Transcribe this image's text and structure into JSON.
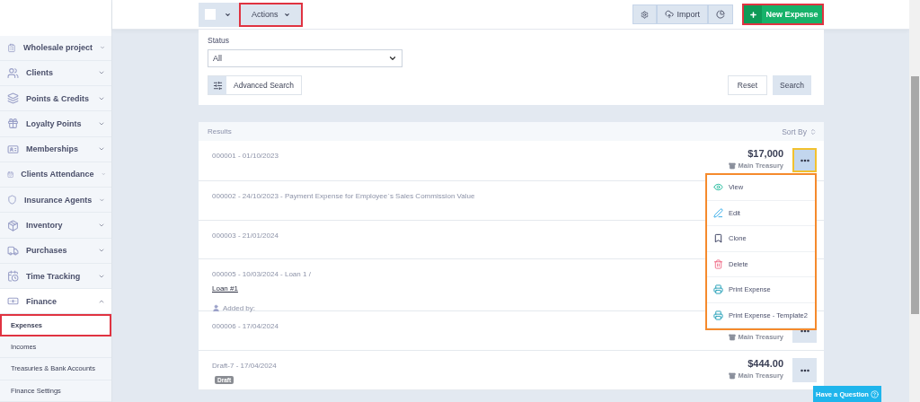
{
  "sidebar": {
    "items": [
      {
        "label": "Wholesale project",
        "expanded": false
      },
      {
        "label": "Clients",
        "expanded": false
      },
      {
        "label": "Points & Credits",
        "expanded": false
      },
      {
        "label": "Loyalty Points",
        "expanded": false
      },
      {
        "label": "Memberships",
        "expanded": false
      },
      {
        "label": "Clients Attendance",
        "expanded": false
      },
      {
        "label": "Insurance Agents",
        "expanded": false
      },
      {
        "label": "Inventory",
        "expanded": false
      },
      {
        "label": "Purchases",
        "expanded": false
      },
      {
        "label": "Time Tracking",
        "expanded": false
      },
      {
        "label": "Finance",
        "expanded": true,
        "children": [
          {
            "label": "Expenses",
            "selected": true,
            "highlighted": true
          },
          {
            "label": "Incomes",
            "selected": false,
            "highlighted": false
          },
          {
            "label": "Treasuries & Bank Accounts",
            "selected": false,
            "highlighted": false
          },
          {
            "label": "Finance Settings",
            "selected": false,
            "highlighted": false
          }
        ]
      }
    ]
  },
  "toolbar": {
    "select_all": {
      "checked": false
    },
    "actions": {
      "label": "Actions",
      "highlighted": true
    },
    "import": "Import",
    "new_button": {
      "label": "New Expense",
      "highlighted": true
    }
  },
  "filters": {
    "status_label": "Status",
    "status_value": "All",
    "advanced_search": "Advanced Search",
    "reset": "Reset",
    "search": "Search"
  },
  "results": {
    "title": "Results",
    "sort": "Sort By",
    "rows": [
      {
        "title": "000001 - 01/10/2023",
        "amount": "$17,000",
        "treasury": "Main Treasury",
        "actions_visible": true,
        "menu_open": true
      },
      {
        "title": "000002 - 24/10/2023 - Payment Expense for Employee`s Sales Commission Value",
        "actions_visible": false,
        "menu_open": false
      },
      {
        "title": "000003 - 21/01/2024",
        "actions_visible": false,
        "menu_open": false
      },
      {
        "title": "000005 - 10/03/2024 - Loan 1 /",
        "link": "Loan #1",
        "added_by": "Added by:",
        "actions_visible": false,
        "menu_open": false
      },
      {
        "title": "000006 - 17/04/2024",
        "treasury": "Main Treasury",
        "actions_visible": true,
        "menu_open": false
      },
      {
        "title": "Draft-7 - 17/04/2024",
        "badge": "Draft",
        "amount": "$444.00",
        "treasury": "Main Treasury",
        "actions_visible": true,
        "menu_open": false
      }
    ]
  },
  "row_menu": {
    "items": [
      {
        "label": "View"
      },
      {
        "label": "Edit"
      },
      {
        "label": "Clone"
      },
      {
        "label": "Delete"
      },
      {
        "label": "Print Expense"
      },
      {
        "label": "Print Expense - Template2"
      }
    ]
  },
  "help_button": "Have a Question"
}
